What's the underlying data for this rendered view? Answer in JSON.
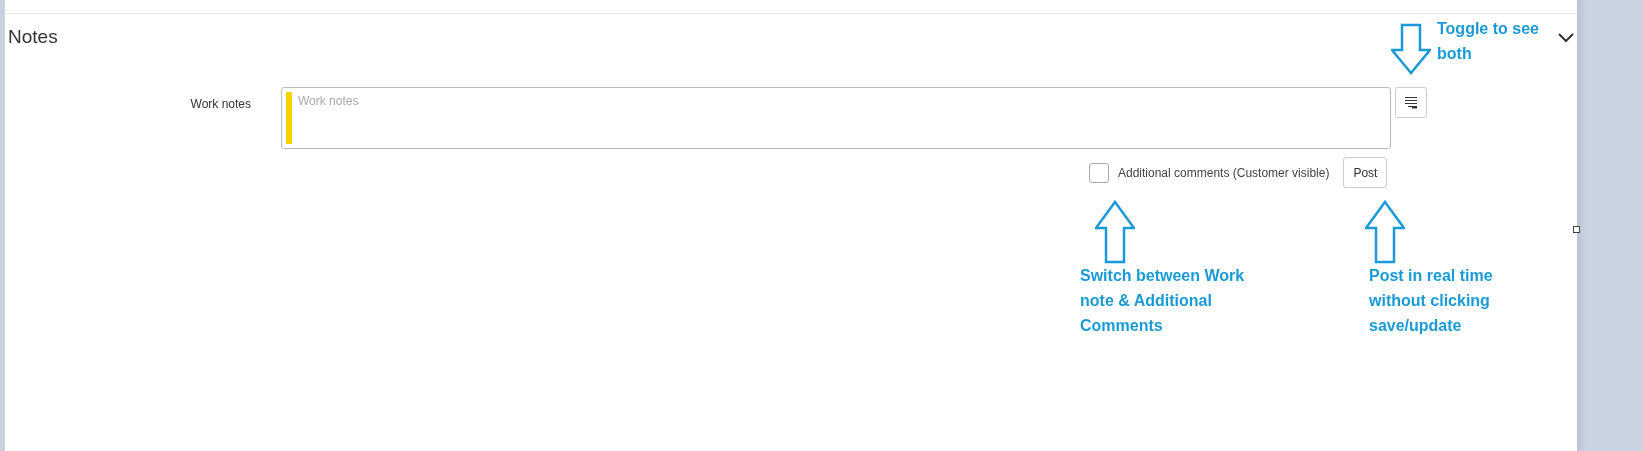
{
  "section": {
    "title": "Notes",
    "expanded": true
  },
  "work_notes": {
    "label": "Work notes",
    "placeholder": "Work notes"
  },
  "additional_comments": {
    "label": "Additional comments (Customer visible)",
    "checked": false
  },
  "post_button": "Post",
  "annotations": [
    {
      "kind": "down",
      "text": "Toggle to see both"
    },
    {
      "kind": "up",
      "text": "Switch between Work note & Additional Comments"
    },
    {
      "kind": "up",
      "text": "Post in real time without clicking save/update"
    }
  ]
}
